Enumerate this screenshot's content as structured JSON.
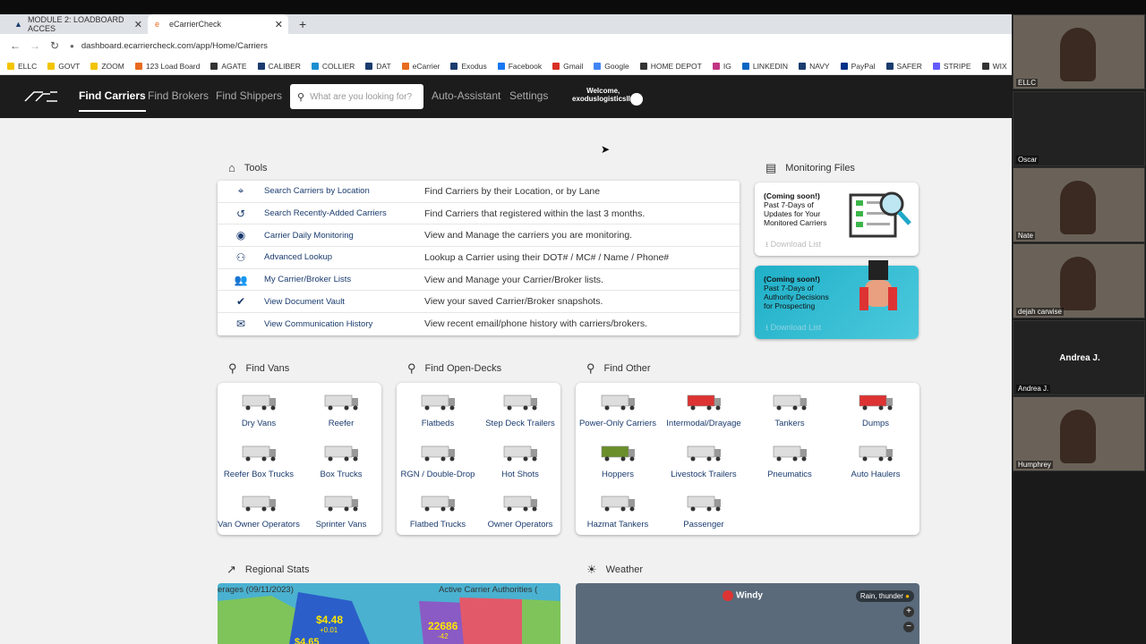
{
  "browser": {
    "tabs": [
      {
        "title": "MODULE 2: LOADBOARD ACCES"
      },
      {
        "title": "eCarrierCheck"
      }
    ],
    "url": "dashboard.ecarriercheck.com/app/Home/Carriers",
    "bookmarks": [
      {
        "label": "ELLC",
        "color": "#f2c400"
      },
      {
        "label": "GOVT",
        "color": "#f2c400"
      },
      {
        "label": "ZOOM",
        "color": "#f2c400"
      },
      {
        "label": "123 Load Board",
        "color": "#e86b1f"
      },
      {
        "label": "AGATE",
        "color": "#333"
      },
      {
        "label": "CALIBER",
        "color": "#1a3b6e"
      },
      {
        "label": "COLLIER",
        "color": "#1a8fd1"
      },
      {
        "label": "DAT",
        "color": "#1a3b6e"
      },
      {
        "label": "eCarrier",
        "color": "#e86b1f"
      },
      {
        "label": "Exodus",
        "color": "#1a3b6e"
      },
      {
        "label": "Facebook",
        "color": "#1877f2"
      },
      {
        "label": "Gmail",
        "color": "#d93025"
      },
      {
        "label": "Google",
        "color": "#4285f4"
      },
      {
        "label": "HOME DEPOT",
        "color": "#333"
      },
      {
        "label": "IG",
        "color": "#c13584"
      },
      {
        "label": "LINKEDIN",
        "color": "#0a66c2"
      },
      {
        "label": "NAVY",
        "color": "#1a3b6e"
      },
      {
        "label": "PayPal",
        "color": "#003087"
      },
      {
        "label": "SAFER",
        "color": "#1a3b6e"
      },
      {
        "label": "STRIPE",
        "color": "#635bff"
      },
      {
        "label": "WIX",
        "color": "#333"
      }
    ]
  },
  "appnav": {
    "links": {
      "carriers": "Find Carriers",
      "brokers": "Find Brokers",
      "shippers": "Find Shippers",
      "auto": "Auto-Assistant",
      "settings": "Settings"
    },
    "search_placeholder": "What are you looking for?",
    "welcome_line1": "Welcome,",
    "welcome_line2": "exoduslogisticsllc"
  },
  "tools": {
    "heading": "Tools",
    "rows": [
      {
        "icon": "location-target-icon",
        "label": "Search Carriers by Location",
        "desc": "Find Carriers by their Location, or by Lane"
      },
      {
        "icon": "history-icon",
        "label": "Search Recently-Added Carriers",
        "desc": "Find Carriers that registered within the last 3 months."
      },
      {
        "icon": "eye-icon",
        "label": "Carrier Daily Monitoring",
        "desc": "View and Manage the carriers you are monitoring."
      },
      {
        "icon": "person-search-icon",
        "label": "Advanced Lookup",
        "desc": "Lookup a Carrier using their DOT# / MC# / Name / Phone#"
      },
      {
        "icon": "people-icon",
        "label": "My Carrier/Broker Lists",
        "desc": "View and Manage your Carrier/Broker lists."
      },
      {
        "icon": "verified-icon",
        "label": "View Document Vault",
        "desc": "View your saved Carrier/Broker snapshots."
      },
      {
        "icon": "mail-icon",
        "label": "View Communication History",
        "desc": "View recent email/phone history with carriers/brokers."
      }
    ]
  },
  "monitoring": {
    "heading": "Monitoring Files",
    "card1": {
      "badge": "(Coming soon!)",
      "text": "Past 7-Days of Updates for Your Monitored Carriers",
      "download": "Download List"
    },
    "card2": {
      "badge": "(Coming soon!)",
      "text": "Past 7-Days of Authority Decisions for Prospecting",
      "download": "Download List"
    }
  },
  "vans": {
    "heading": "Find Vans",
    "items": [
      "Dry Vans",
      "Reefer",
      "Reefer Box Trucks",
      "Box Trucks",
      "Van Owner Operators",
      "Sprinter Vans"
    ]
  },
  "decks": {
    "heading": "Find Open-Decks",
    "items": [
      "Flatbeds",
      "Step Deck Trailers",
      "RGN / Double-Drop",
      "Hot Shots",
      "Flatbed Trucks",
      "Owner Operators"
    ]
  },
  "other": {
    "heading": "Find Other",
    "items": [
      "Power-Only Carriers",
      "Intermodal/Drayage",
      "Tankers",
      "Dumps",
      "Hoppers",
      "Livestock Trailers",
      "Pneumatics",
      "Auto Haulers",
      "Hazmat Tankers",
      "Passenger"
    ]
  },
  "stats": {
    "heading": "Regional Stats",
    "left_label": "erages (09/11/2023)",
    "right_label": "Active Carrier Authorities (",
    "price": "$4.48",
    "price_delta": "+0.01",
    "price2": "$4.65",
    "count": "22686",
    "count_delta": "-42"
  },
  "weather": {
    "heading": "Weather",
    "brand": "Windy",
    "legend": "Rain, thunder"
  },
  "participants": [
    "ELLC",
    "Oscar",
    "Nate",
    "dejah carwise",
    "Andrea J.",
    "Humphrey"
  ],
  "participant_center": "Andrea J."
}
